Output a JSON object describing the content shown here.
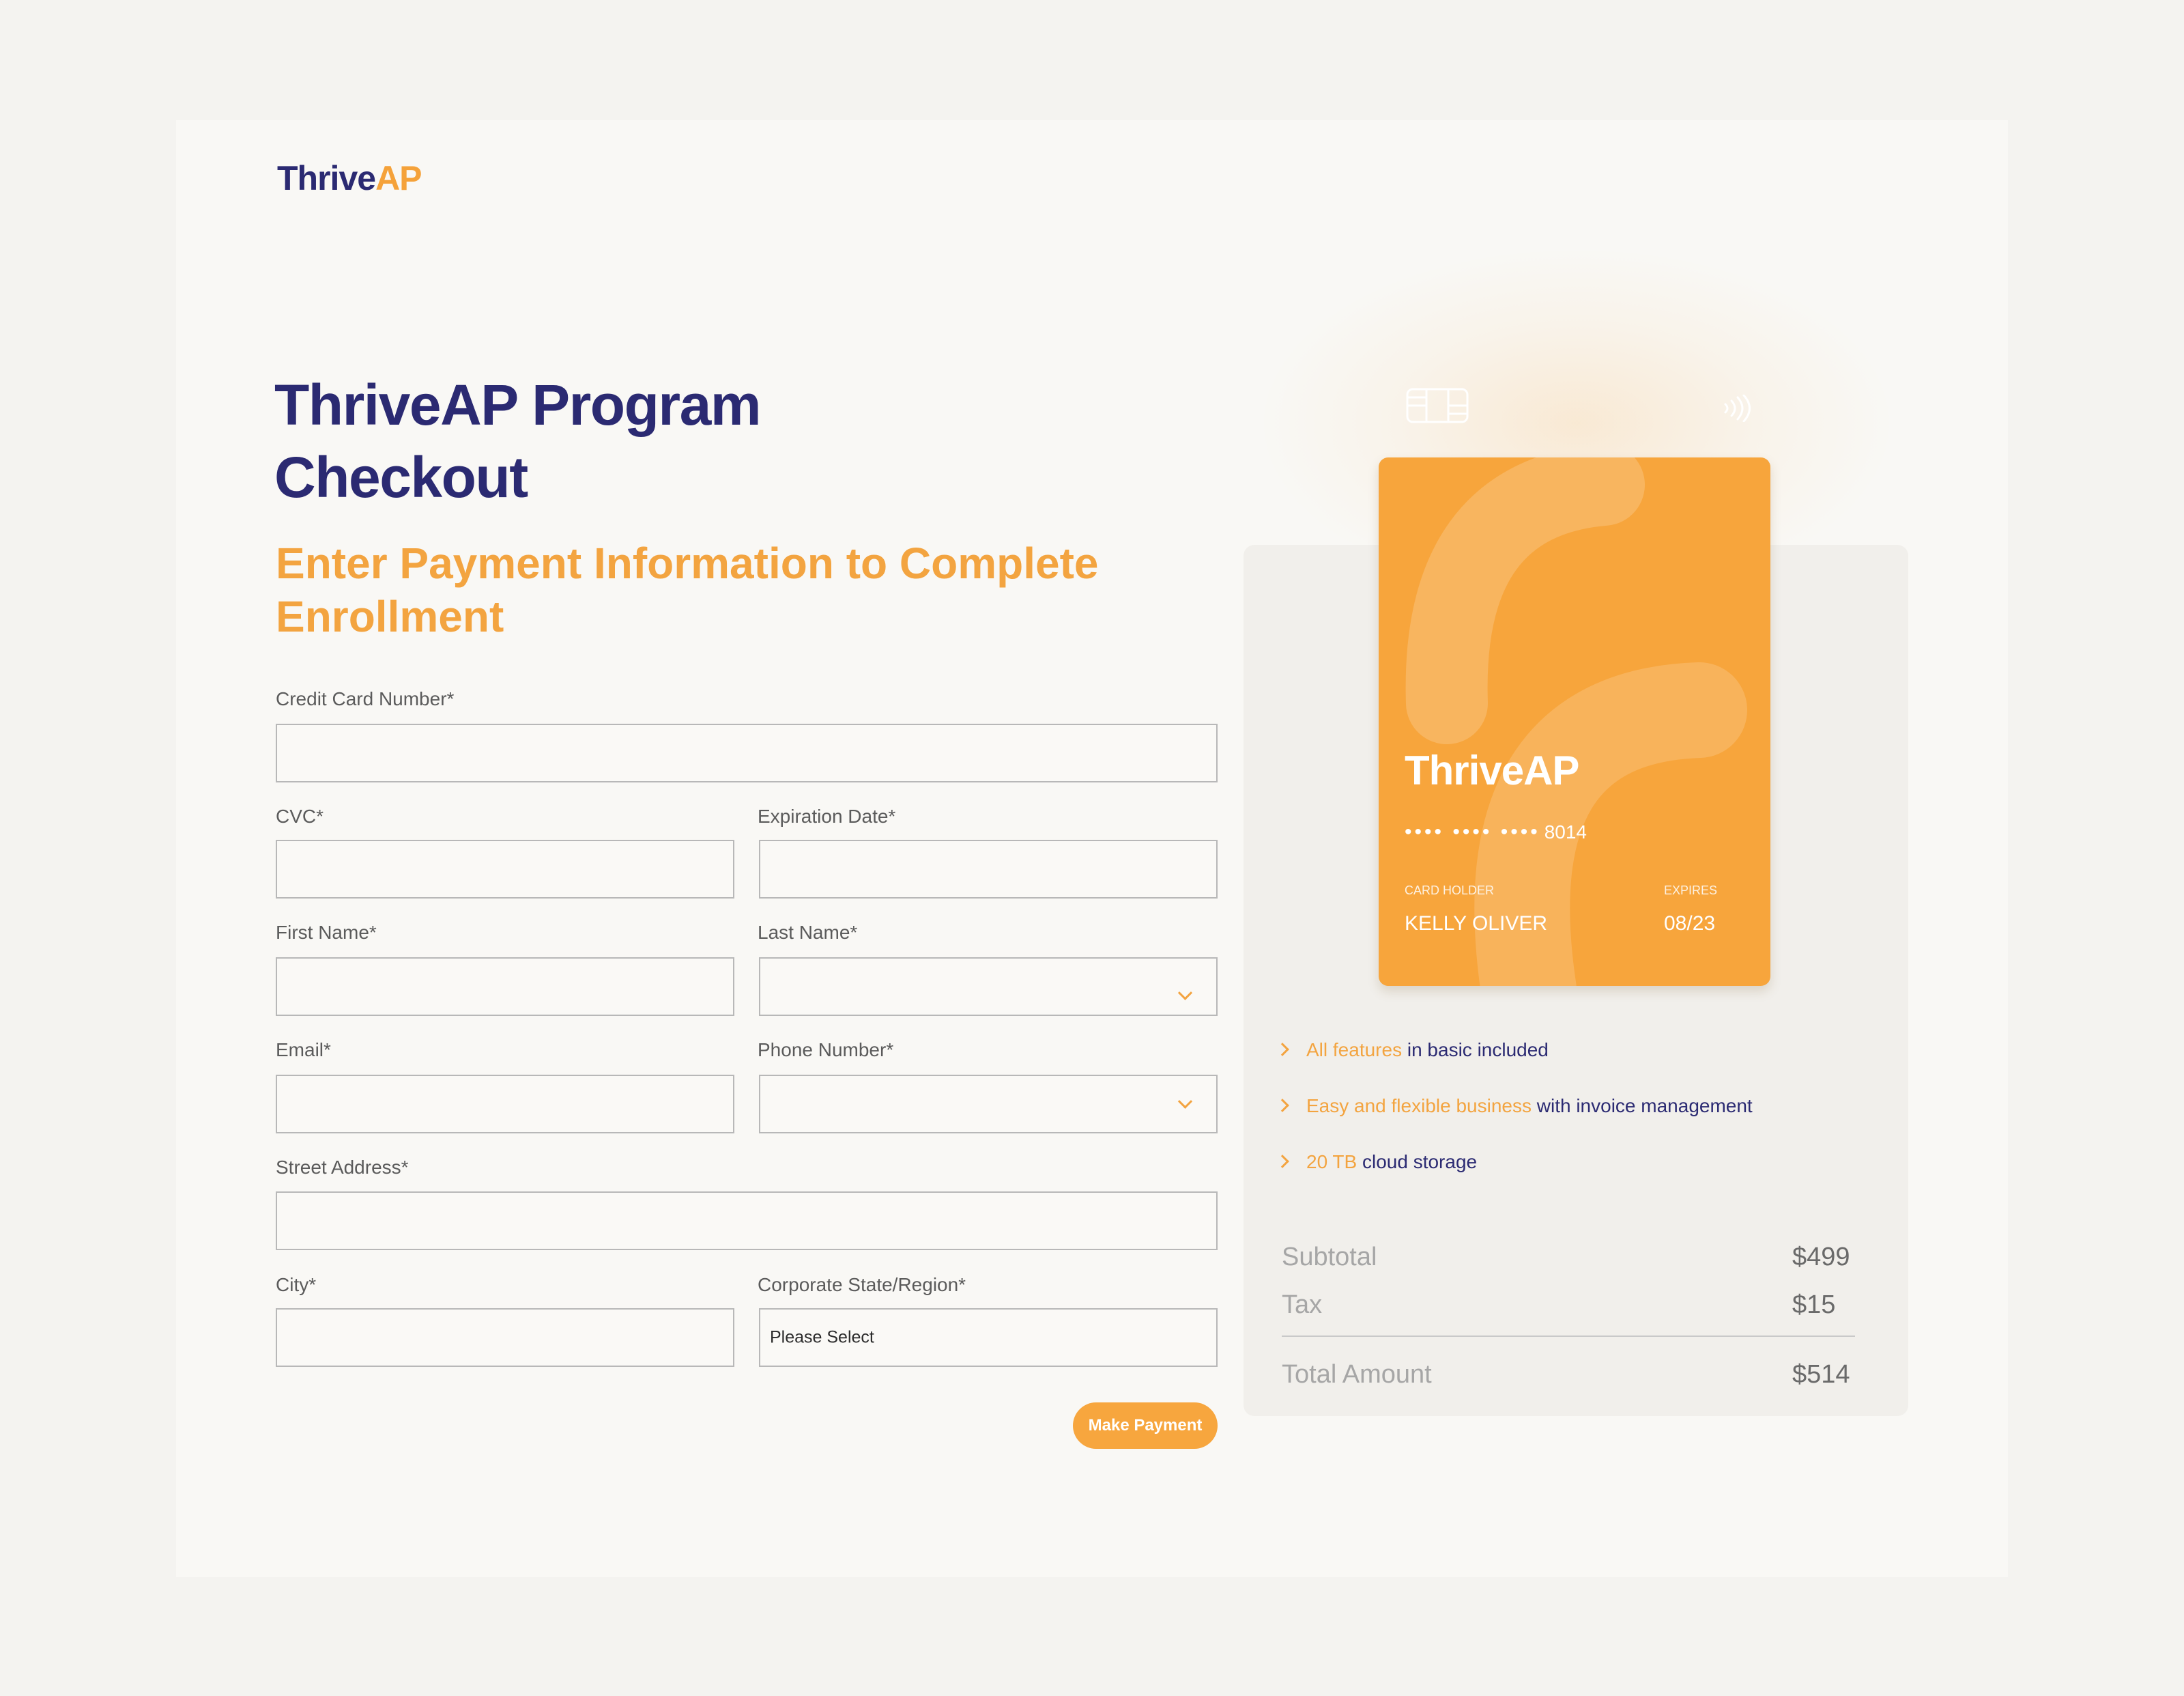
{
  "brand": {
    "logo_part1": "Thri",
    "logo_part2": "ve",
    "logo_part3": "AP"
  },
  "header": {
    "title": "ThriveAP Program Checkout",
    "subtitle": "Enter Payment Information to Complete Enrollment"
  },
  "form": {
    "card_number_label": "Credit Card Number*",
    "cvc_label": "CVC*",
    "expiration_label": "Expiration Date*",
    "first_name_label": "First Name*",
    "last_name_label": "Last Name*",
    "email_label": "Email*",
    "phone_label": "Phone Number*",
    "street_label": "Street Address*",
    "city_label": "City*",
    "state_label": "Corporate State/Region*",
    "state_value": "Please Select",
    "submit_label": "Make Payment"
  },
  "card": {
    "logo_part1": "Thri",
    "logo_part2": "ve",
    "logo_part3": "AP",
    "masked": "•••• •••• ••••",
    "last4": "8014",
    "holder_label": "CARD HOLDER",
    "holder_name": "KELLY OLIVER",
    "expires_label": "EXPIRES",
    "expires_value": "08/23"
  },
  "features": [
    {
      "highlight": "All features",
      "text": " in basic included"
    },
    {
      "highlight": "Easy and flexible business",
      "text": " with invoice management"
    },
    {
      "highlight": "20 TB",
      "text": " cloud storage"
    }
  ],
  "summary": {
    "subtotal_label": "Subtotal",
    "subtotal_value": "$499",
    "tax_label": "Tax",
    "tax_value": "$15",
    "total_label": "Total Amount",
    "total_value": "$514"
  },
  "colors": {
    "brand_navy": "#2b2a72",
    "brand_orange": "#f7a63e",
    "background": "#f4f3f0"
  },
  "icons": [
    "chip-icon",
    "contactless-icon",
    "chevron-right-icon",
    "chevron-down-icon"
  ]
}
